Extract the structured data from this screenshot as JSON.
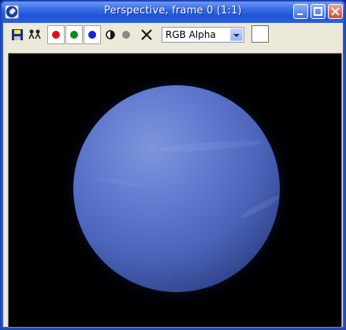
{
  "window": {
    "title": "Perspective, frame 0 (1:1)"
  },
  "toolbar": {
    "channel_select": {
      "selected": "RGB Alpha"
    },
    "icons": {
      "save": "save-icon",
      "clone": "clone-icon",
      "red": "red-channel-icon",
      "green": "green-channel-icon",
      "blue": "blue-channel-icon",
      "alpha": "alpha-channel-icon",
      "mono": "monochrome-icon",
      "clear": "clear-x-icon"
    },
    "colors": {
      "red": "#e01010",
      "green": "#108a18",
      "blue": "#1426d6"
    }
  },
  "viewport": {
    "background": "#000000",
    "planet_color": "#627bd0"
  }
}
